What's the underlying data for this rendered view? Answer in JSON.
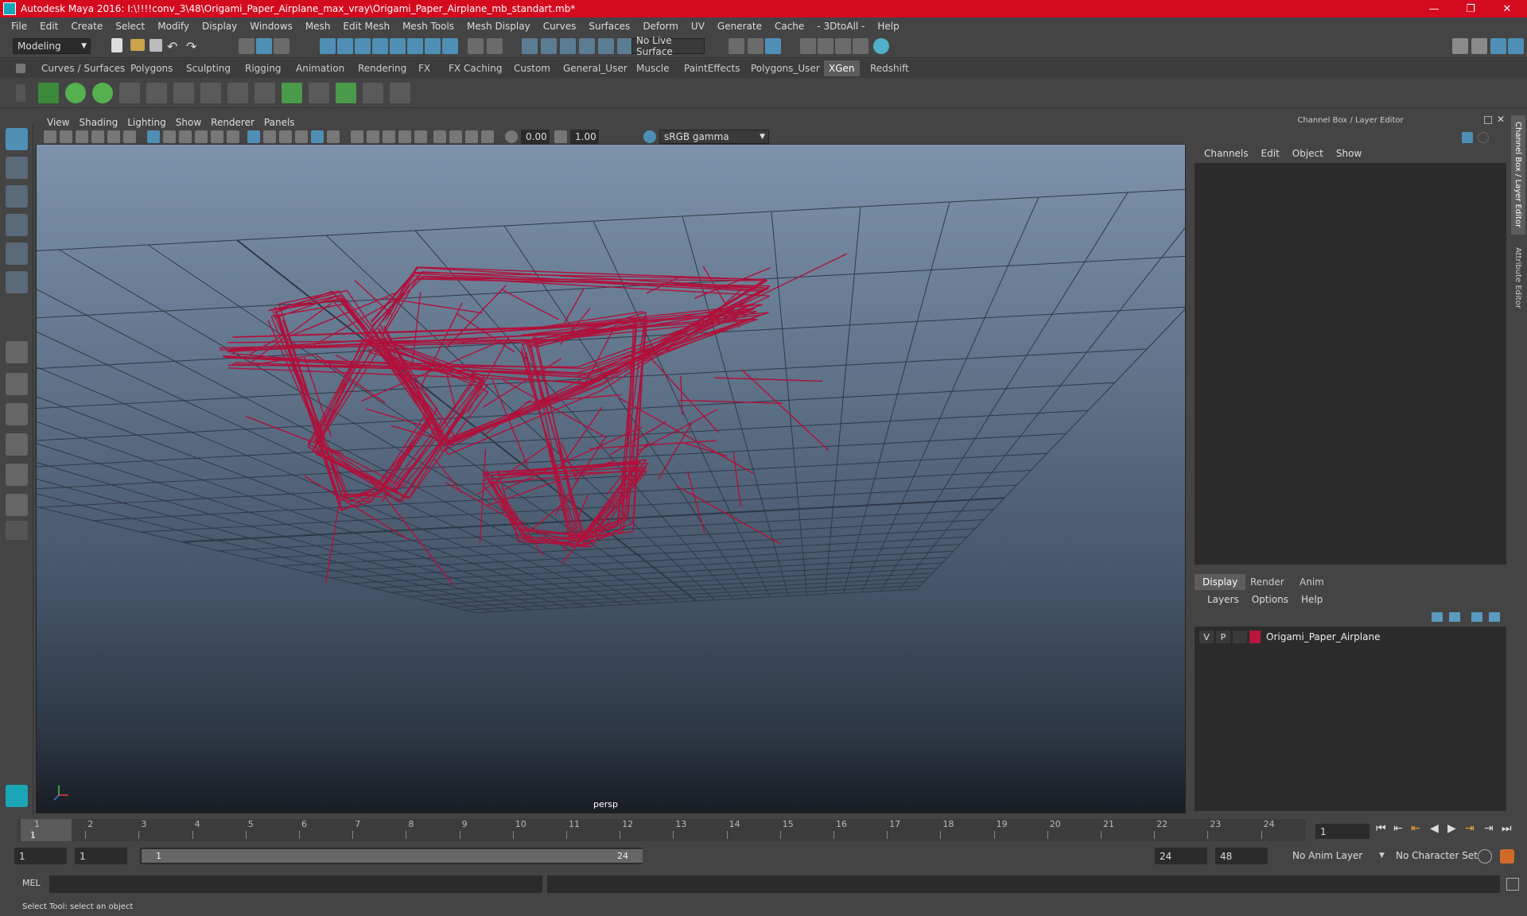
{
  "window": {
    "title": "Autodesk Maya 2016: I:\\!!!!conv_3\\48\\Origami_Paper_Airplane_max_vray\\Origami_Paper_Airplane_mb_standart.mb*",
    "minimize": "—",
    "restore": "❐",
    "close": "✕"
  },
  "menu": [
    "File",
    "Edit",
    "Create",
    "Select",
    "Modify",
    "Display",
    "Windows",
    "Mesh",
    "Edit Mesh",
    "Mesh Tools",
    "Mesh Display",
    "Curves",
    "Surfaces",
    "Deform",
    "UV",
    "Generate",
    "Cache",
    "- 3DtoAll -",
    "Help"
  ],
  "statusline": {
    "mode": "Modeling",
    "live_surface": "No Live Surface"
  },
  "shelf_tabs": [
    "Curves / Surfaces",
    "Polygons",
    "Sculpting",
    "Rigging",
    "Animation",
    "Rendering",
    "FX",
    "FX Caching",
    "Custom",
    "General_User",
    "Muscle",
    "PaintEffects",
    "Polygons_User",
    "XGen",
    "Redshift"
  ],
  "shelf_active": "XGen",
  "viewport": {
    "menu": [
      "View",
      "Shading",
      "Lighting",
      "Show",
      "Renderer",
      "Panels"
    ],
    "exposure": "0.00",
    "gamma": "1.00",
    "color_space": "sRGB gamma",
    "camera_label": "persp"
  },
  "channel_box": {
    "header": "Channel Box / Layer Editor",
    "menu": [
      "Channels",
      "Edit",
      "Object",
      "Show"
    ],
    "side_tab_1": "Channel Box / Layer Editor",
    "side_tab_2": "Attribute Editor"
  },
  "layer_editor": {
    "tabs": [
      "Display",
      "Render",
      "Anim"
    ],
    "active_tab": "Display",
    "menu": [
      "Layers",
      "Options",
      "Help"
    ],
    "layer": {
      "v": "V",
      "p": "P",
      "name": "Origami_Paper_Airplane",
      "color": "#b8173c"
    }
  },
  "timeline": {
    "ticks": [
      "1",
      "2",
      "3",
      "4",
      "5",
      "6",
      "7",
      "8",
      "9",
      "10",
      "11",
      "12",
      "13",
      "14",
      "15",
      "16",
      "17",
      "18",
      "19",
      "20",
      "21",
      "22",
      "23",
      "24"
    ],
    "current_frame": "1",
    "current": "1"
  },
  "range": {
    "start": "1",
    "playback_start": "1",
    "slider_start": "1",
    "slider_end": "24",
    "playback_end": "24",
    "end": "48",
    "anim_layer": "No Anim Layer",
    "character_set": "No Character Set"
  },
  "command_line": {
    "label": "MEL"
  },
  "help_line": "Select Tool: select an object",
  "colors": {
    "wireframe": "#b0103a",
    "accent": "#d40a1e",
    "active_icon": "#4f8fb5"
  }
}
